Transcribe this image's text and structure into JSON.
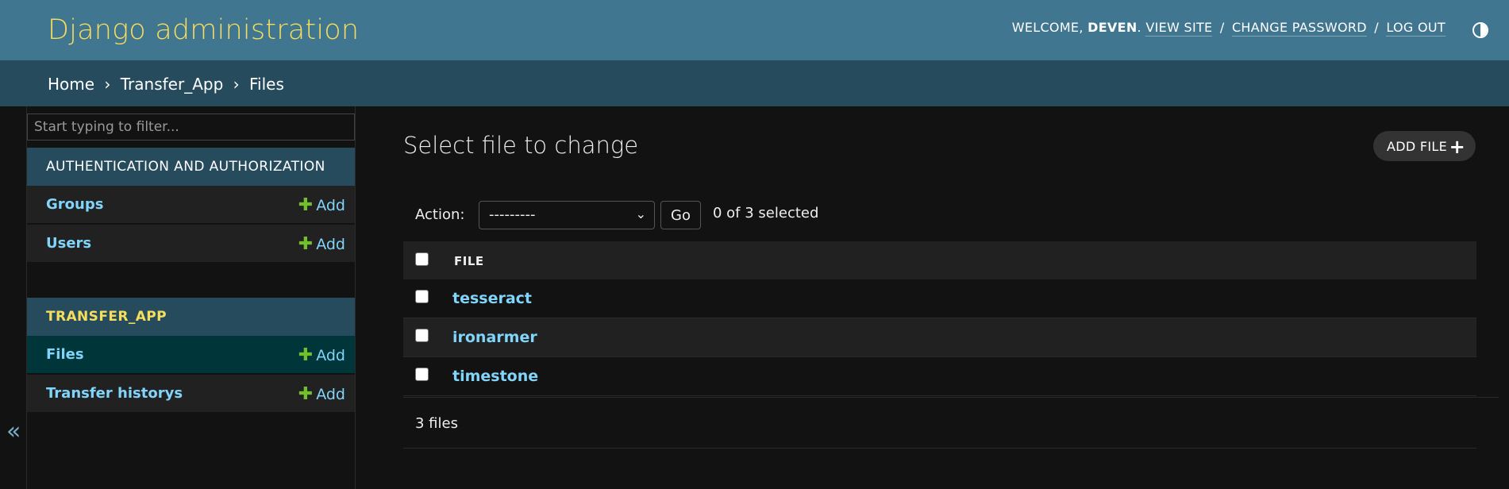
{
  "header": {
    "branding": "Django administration",
    "welcome_prefix": "WELCOME,",
    "username": "DEVEN",
    "welcome_suffix": ".",
    "view_site": "VIEW SITE",
    "change_password": "CHANGE PASSWORD",
    "log_out": "LOG OUT",
    "separator": "/"
  },
  "breadcrumbs": {
    "home": "Home",
    "app": "Transfer_App",
    "current": "Files",
    "separator": "›"
  },
  "sidebar": {
    "filter_placeholder": "Start typing to filter...",
    "collapse_glyph": "«",
    "modules": [
      {
        "caption": "AUTHENTICATION AND AUTHORIZATION",
        "models": [
          {
            "name": "Groups",
            "add": "Add"
          },
          {
            "name": "Users",
            "add": "Add"
          }
        ]
      },
      {
        "caption": "TRANSFER_APP",
        "models": [
          {
            "name": "Files",
            "add": "Add",
            "current": true
          },
          {
            "name": "Transfer historys",
            "add": "Add"
          }
        ]
      }
    ]
  },
  "main": {
    "title": "Select file to change",
    "add_button": "ADD FILE",
    "action_label": "Action:",
    "action_selected": "---------",
    "go_label": "Go",
    "selected_count": "0 of 3 selected",
    "column_header": "FILE",
    "rows": [
      "tesseract",
      "ironarmer",
      "timestone"
    ],
    "paginator": "3 files"
  },
  "colors": {
    "header_bg": "#417690",
    "breadcrumbs_bg": "#264b5d",
    "branding": "#f5dd5d",
    "link": "#81d4fa",
    "add_plus": "#70bf2b",
    "current_model_bg": "#00363a",
    "page_bg": "#121212"
  }
}
